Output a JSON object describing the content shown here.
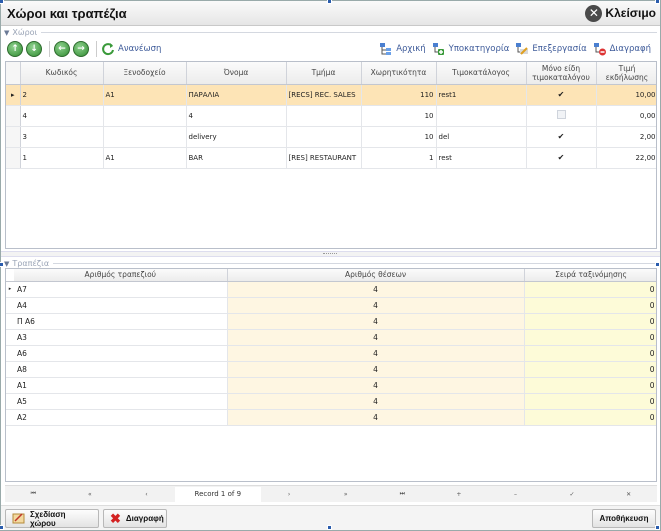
{
  "window": {
    "title": "Χώροι και τραπέζια",
    "close_label": "Κλείσιμο"
  },
  "spaces_group": {
    "title": "Χώροι"
  },
  "toolbar": {
    "refresh_label": "Ανανέωση",
    "home_label": "Αρχική",
    "subcategory_label": "Υποκατηγορία",
    "edit_label": "Επεξεργασία",
    "delete_label": "Διαγραφή"
  },
  "spaces_grid": {
    "columns": [
      "Κωδικός",
      "Ξενοδοχείο",
      "Όνομα",
      "Τμήμα",
      "Χωρητικότητα",
      "Τιμοκατάλογος",
      "Μόνο είδη τιμοκαταλόγου",
      "Τιμή εκδήλωσης"
    ],
    "rows": [
      {
        "code": "2",
        "hotel": "A1",
        "name": "ΠΑΡΑΛΙΑ",
        "dept": "[RECS] REC. SALES",
        "capacity": "110",
        "pricelist": "rest1",
        "only_items": true,
        "price": "10,00",
        "selected": true
      },
      {
        "code": "4",
        "hotel": "",
        "name": "4",
        "dept": "",
        "capacity": "10",
        "pricelist": "",
        "only_items": false,
        "price": "0,00",
        "selected": false
      },
      {
        "code": "3",
        "hotel": "",
        "name": "delivery",
        "dept": "",
        "capacity": "10",
        "pricelist": "del",
        "only_items": true,
        "price": "2,00",
        "selected": false
      },
      {
        "code": "1",
        "hotel": "A1",
        "name": "BAR",
        "dept": "[RES] RESTAURANT",
        "capacity": "1",
        "pricelist": "rest",
        "only_items": true,
        "price": "22,00",
        "selected": false
      }
    ]
  },
  "tables_group": {
    "title": "Τραπέζια"
  },
  "tables_grid": {
    "columns": [
      "Αριθμός τραπεζιού",
      "Αριθμός θέσεων",
      "Σειρά ταξινόμησης"
    ],
    "rows": [
      {
        "number": "A7",
        "seats": "4",
        "order": "0"
      },
      {
        "number": "A4",
        "seats": "4",
        "order": "0"
      },
      {
        "number": "Π A6",
        "seats": "4",
        "order": "0"
      },
      {
        "number": "A3",
        "seats": "4",
        "order": "0"
      },
      {
        "number": "A6",
        "seats": "4",
        "order": "0"
      },
      {
        "number": "A8",
        "seats": "4",
        "order": "0"
      },
      {
        "number": "A1",
        "seats": "4",
        "order": "0"
      },
      {
        "number": "A5",
        "seats": "4",
        "order": "0"
      },
      {
        "number": "A2",
        "seats": "4",
        "order": "0"
      }
    ]
  },
  "navigator": {
    "record_text": "Record 1 of 9",
    "buttons": [
      "⏮",
      "«",
      "‹",
      "›",
      "»",
      "⏭",
      "+",
      "–",
      "✓",
      "✕"
    ]
  },
  "bottom": {
    "design_label": "Σχεδίαση χώρου",
    "delete_label": "Διαγραφή",
    "save_label": "Αποθήκευση"
  }
}
